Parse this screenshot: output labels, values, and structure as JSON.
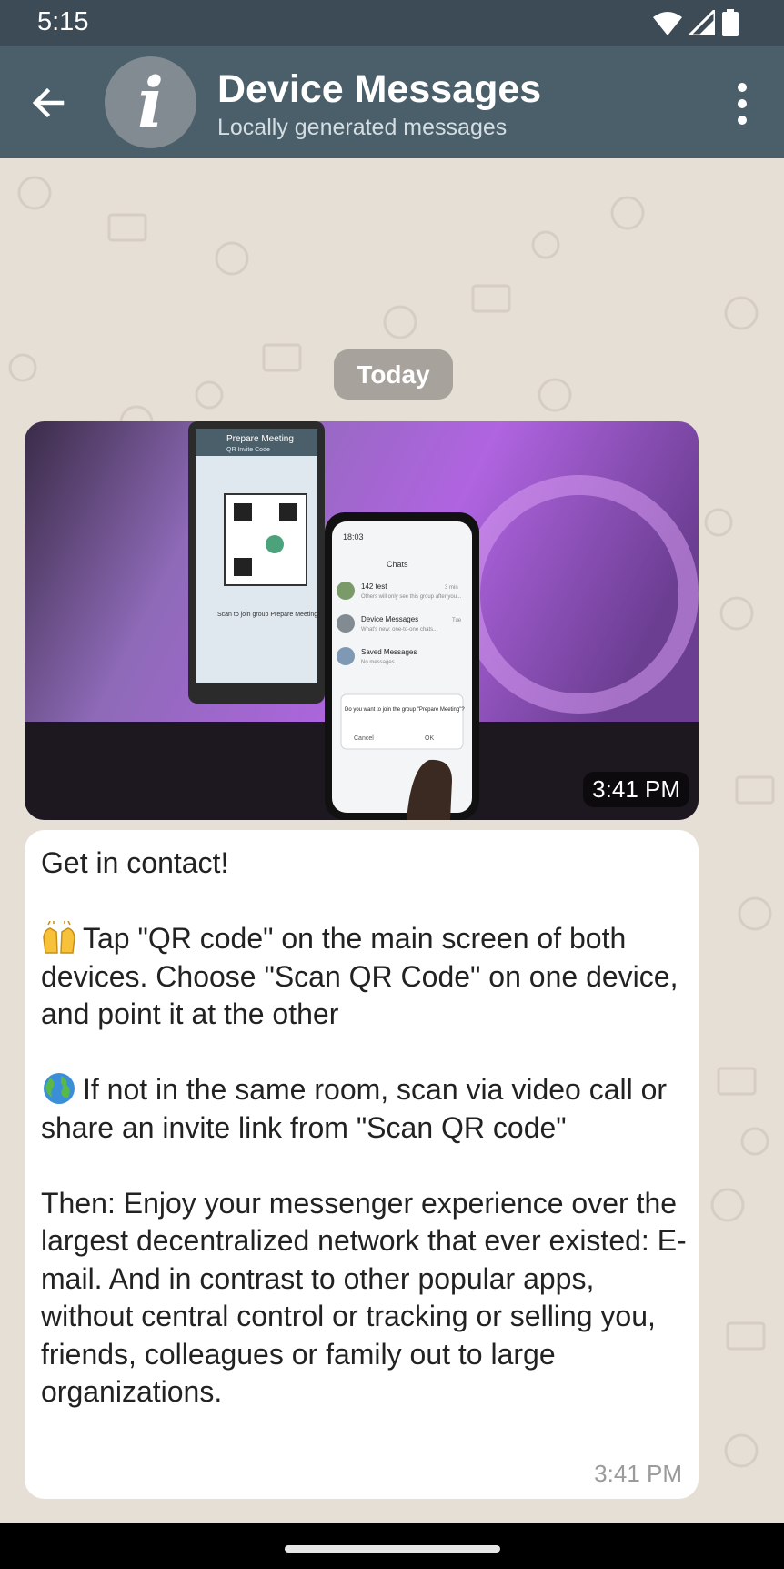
{
  "status_bar": {
    "time": "5:15",
    "icons": [
      "wifi-icon",
      "signal-icon",
      "battery-icon"
    ]
  },
  "header": {
    "back_icon": "arrow-back-icon",
    "avatar_letter": "i",
    "title": "Device Messages",
    "subtitle": "Locally generated messages",
    "menu_icon": "more-vert-icon"
  },
  "chat": {
    "date_chip": "Today",
    "image_message": {
      "time": "3:41 PM",
      "photo": {
        "left_phone_title": "Prepare Meeting",
        "left_phone_subtitle": "QR Invite Code",
        "left_phone_caption": "Scan to join group Prepare Meeting",
        "right_phone_time": "18:03",
        "right_phone_title": "Chats",
        "chat_rows": [
          {
            "name": "142 test",
            "preview": "Others will only see this group after you...",
            "time": "3 min"
          },
          {
            "name": "Device Messages",
            "preview": "What's new: one-to-one chats...",
            "time": "Tue"
          },
          {
            "name": "Saved Messages",
            "preview": "No messages."
          }
        ],
        "dialog_text": "Do you want to join the group \"Prepare Meeting\"?",
        "dialog_cancel": "Cancel",
        "dialog_ok": "OK"
      }
    },
    "text_message": {
      "line1": "Get in contact!",
      "para_qr": "Tap \"QR code\" on the main screen of both devices. Choose \"Scan QR Code\" on one device, and point it at the other",
      "para_remote": "If not in the same room, scan via video call or share an invite link from \"Scan QR code\"",
      "para_then": "Then: Enjoy your messenger experience over the largest decentralized network that ever existed: E-mail. And in contrast to other popular apps, without central control or tracking or selling you, friends, colleagues or family out to large organizations.",
      "time": "3:41 PM"
    }
  },
  "colors": {
    "status_bar": "#3c4b55",
    "app_bar": "#4b5f6b",
    "chat_bg": "#e6dfd6",
    "bubble": "#ffffff"
  }
}
